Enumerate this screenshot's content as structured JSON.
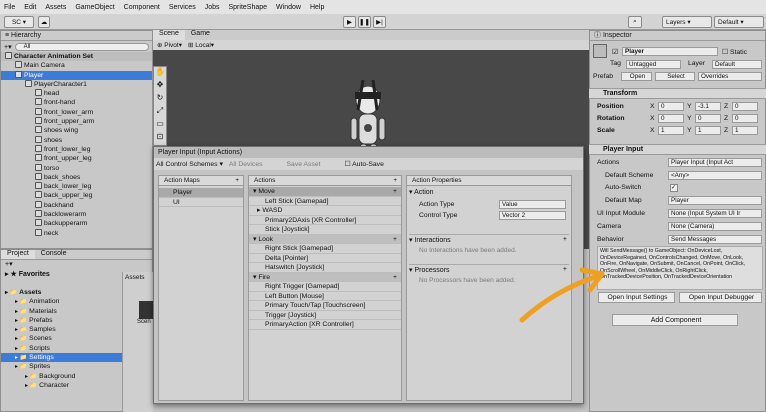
{
  "menu": [
    "File",
    "Edit",
    "Assets",
    "GameObject",
    "Component",
    "Services",
    "Jobs",
    "SpriteShape",
    "Window",
    "Help"
  ],
  "toolbar": {
    "account": "SC ▾",
    "layers": "Layers",
    "layout": "Default"
  },
  "hierarchy": {
    "tab": "Hierarchy",
    "search_placeholder": "All",
    "items": [
      {
        "label": "Character Animation Set",
        "depth": 0,
        "bold": true
      },
      {
        "label": "Main Camera",
        "depth": 1
      },
      {
        "label": "Player",
        "depth": 1,
        "selected": true
      },
      {
        "label": "PlayerCharacter1",
        "depth": 2
      },
      {
        "label": "head",
        "depth": 3
      },
      {
        "label": "front-hand",
        "depth": 3
      },
      {
        "label": "front_lower_arm",
        "depth": 3
      },
      {
        "label": "front_upper_arm",
        "depth": 3
      },
      {
        "label": "shoes wing",
        "depth": 3
      },
      {
        "label": "shoes",
        "depth": 3
      },
      {
        "label": "front_lower_leg",
        "depth": 3
      },
      {
        "label": "front_upper_leg",
        "depth": 3
      },
      {
        "label": "torso",
        "depth": 3
      },
      {
        "label": "back_shoes",
        "depth": 3
      },
      {
        "label": "back_lower_leg",
        "depth": 3
      },
      {
        "label": "back_upper_leg",
        "depth": 3
      },
      {
        "label": "backhand",
        "depth": 3
      },
      {
        "label": "backlowerarm",
        "depth": 3
      },
      {
        "label": "backupperarm",
        "depth": 3
      },
      {
        "label": "neck",
        "depth": 3
      }
    ]
  },
  "scene": {
    "tabs": [
      "Scene",
      "Game"
    ],
    "pivot": "Pivot",
    "local": "Local"
  },
  "project": {
    "tabs": [
      "Project",
      "Console"
    ],
    "favorites": "Favorites",
    "assets_header": "Assets",
    "tree": [
      {
        "label": "Assets",
        "depth": 0,
        "bold": true
      },
      {
        "label": "Animation",
        "depth": 1
      },
      {
        "label": "Materials",
        "depth": 1
      },
      {
        "label": "Prefabs",
        "depth": 1
      },
      {
        "label": "Samples",
        "depth": 1
      },
      {
        "label": "Scenes",
        "depth": 1
      },
      {
        "label": "Scripts",
        "depth": 1
      },
      {
        "label": "Settings",
        "depth": 1,
        "selected": true
      },
      {
        "label": "Sprites",
        "depth": 1
      },
      {
        "label": "Background",
        "depth": 2
      },
      {
        "label": "Character",
        "depth": 2
      }
    ],
    "thumb_label": "Scen"
  },
  "input_window": {
    "title": "Player Input (Input Actions)",
    "scheme": "All Control Schemes ▾",
    "devices": "All Devices",
    "save": "Save Asset",
    "autosave": "Auto-Save",
    "maps_header": "Action Maps",
    "maps": [
      "Player",
      "UI"
    ],
    "actions_header": "Actions",
    "actions": [
      {
        "label": "Move",
        "type": "action"
      },
      {
        "label": "Left Stick [Gamepad]",
        "type": "binding"
      },
      {
        "label": "WASD",
        "type": "composite"
      },
      {
        "label": "Primary2DAxis [XR Controller]",
        "type": "binding"
      },
      {
        "label": "Stick [Joystick]",
        "type": "binding"
      },
      {
        "label": "Look",
        "type": "action"
      },
      {
        "label": "Right Stick [Gamepad]",
        "type": "binding"
      },
      {
        "label": "Delta [Pointer]",
        "type": "binding"
      },
      {
        "label": "Hatswitch [Joystick]",
        "type": "binding"
      },
      {
        "label": "Fire",
        "type": "action"
      },
      {
        "label": "Right Trigger [Gamepad]",
        "type": "binding"
      },
      {
        "label": "Left Button [Mouse]",
        "type": "binding"
      },
      {
        "label": "Primary Touch/Tap [Touchscreen]",
        "type": "binding"
      },
      {
        "label": "Trigger [Joystick]",
        "type": "binding"
      },
      {
        "label": "PrimaryAction [XR Controller]",
        "type": "binding"
      }
    ],
    "props_header": "Action Properties",
    "action_section": "Action",
    "action_type_label": "Action Type",
    "action_type": "Value",
    "control_type_label": "Control Type",
    "control_type": "Vector 2",
    "interactions": "Interactions",
    "no_interactions": "No Interactions have been added.",
    "processors": "Processors",
    "no_processors": "No Processors have been added."
  },
  "inspector": {
    "tab": "Inspector",
    "name": "Player",
    "static": "Static",
    "tag_label": "Tag",
    "tag": "Untagged",
    "layer_label": "Layer",
    "layer": "Default",
    "prefab_label": "Prefab",
    "open": "Open",
    "select": "Select",
    "overrides": "Overrides",
    "transform": "Transform",
    "rows": [
      {
        "label": "Position",
        "x": "0",
        "y": "-3.1",
        "z": "0"
      },
      {
        "label": "Rotation",
        "x": "0",
        "y": "0",
        "z": "0"
      },
      {
        "label": "Scale",
        "x": "1",
        "y": "1",
        "z": "1"
      }
    ],
    "player_input": "Player Input",
    "actions_label": "Actions",
    "actions_val": "Player Input (Input Act",
    "default_scheme_label": "Default Scheme",
    "default_scheme": "<Any>",
    "auto_switch_label": "Auto-Switch",
    "auto_switch": "✓",
    "default_map_label": "Default Map",
    "default_map": "Player",
    "ui_module_label": "UI Input Module",
    "ui_module": "None (Input System UI Ir",
    "camera_label": "Camera",
    "camera": "None (Camera)",
    "behavior_label": "Behavior",
    "behavior": "Send Messages",
    "message": "Will SendMessage() to GameObject: OnDeviceLost, OnDeviceRegained, OnControlsChanged, OnMove, OnLook, OnFire, OnNavigate, OnSubmit, OnCancel, OnPoint, OnClick, OnScrollWheel, OnMiddleClick, OnRightClick, OnTrackedDevicePosition, OnTrackedDeviceOrientation",
    "open_settings": "Open Input Settings",
    "open_debugger": "Open Input Debugger",
    "add_component": "Add Component"
  },
  "colors": {
    "selection": "#3d7bd9",
    "arrow": "#f0a020",
    "scene_bg": "#484848"
  }
}
